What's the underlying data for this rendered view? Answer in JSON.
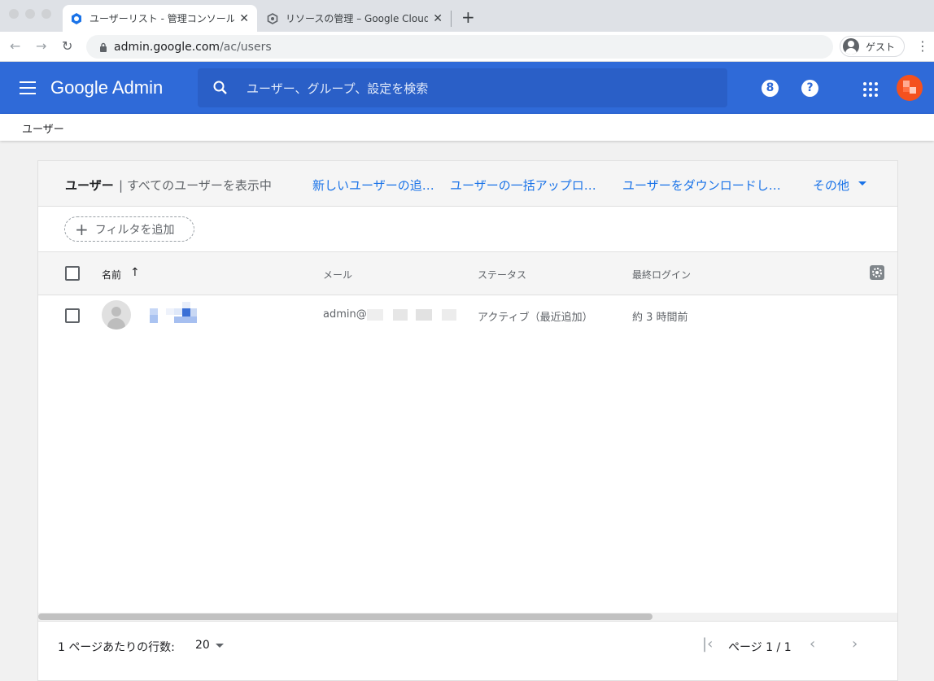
{
  "browser": {
    "tabs": [
      {
        "title": "ユーザーリスト - 管理コンソール",
        "active": true
      },
      {
        "title": "リソースの管理 – Google Cloud P",
        "active": false
      }
    ],
    "new_tab": "+",
    "close": "✕",
    "url_host": "admin.google.com",
    "url_path": "/ac/users",
    "profile_label": "ゲスト"
  },
  "app": {
    "logo": "Google Admin",
    "search_placeholder": "ユーザー、グループ、設定を検索",
    "help_label": "?",
    "timer_label": "8"
  },
  "breadcrumb": "ユーザー",
  "card": {
    "title": "ユーザー",
    "subtitle": "| すべてのユーザーを表示中",
    "actions": [
      "新しいユーザーの追…",
      "ユーザーの一括アップロ…",
      "ユーザーをダウンロードし…"
    ],
    "more": "その他",
    "filter_label": "フィルタを追加"
  },
  "table": {
    "columns": [
      "名前",
      "メール",
      "ステータス",
      "最終ログイン"
    ],
    "sort_icon": "↑",
    "rows": [
      {
        "email": "admin@",
        "status": "アクティブ（最近追加）",
        "last_login": "約 3 時間前"
      }
    ]
  },
  "footer": {
    "rows_per_page_label": "1 ページあたりの行数:",
    "rows_per_page_value": "20",
    "page_label": "ページ 1 / 1"
  },
  "colors": {
    "appbar": "#2f6ad8",
    "link": "#1a73e8",
    "avatar": "#f4511e"
  }
}
